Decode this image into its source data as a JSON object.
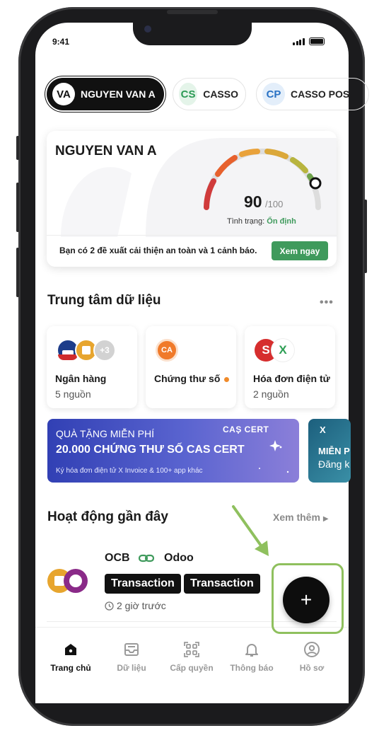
{
  "status_bar": {
    "time": "9:41"
  },
  "accounts": [
    {
      "initials": "VA",
      "name": "NGUYEN VAN A",
      "active": true
    },
    {
      "initials": "CS",
      "name": "CASSO",
      "active": false
    },
    {
      "initials": "CP",
      "name": "CASSO POS",
      "active": false
    }
  ],
  "score_card": {
    "name": "NGUYEN VAN A",
    "score": "90",
    "score_max": "/100",
    "status_label": "Tình trạng: ",
    "status_value": "Ổn định",
    "score_fraction": 0.9,
    "message": "Bạn có 2 đề xuất cải thiện an toàn và 1 cảnh báo.",
    "action_label": "Xem ngay",
    "accent_color": "#3f9a5c"
  },
  "data_center": {
    "title": "Trung tâm dữ liệu",
    "more_icon": "more-dots-icon",
    "cards": [
      {
        "title": "Ngân hàng",
        "subtitle": "5 nguồn",
        "badge": "+3"
      },
      {
        "title": "Chứng thư số",
        "subtitle": "",
        "icon_text": "CA"
      },
      {
        "title": "Hóa đơn điện tử",
        "subtitle": "2 nguồn",
        "icon_text_1": "S",
        "icon_text_2": "X"
      }
    ]
  },
  "banners": [
    {
      "line1": "QUÀ TẶNG MIỄN PHÍ",
      "line2": "20.000 CHỨNG THƯ SỐ CAS CERT",
      "line3": "Ký hóa đơn điện tử X Invoice & 100+ app khác",
      "logo": "CAS CERT"
    },
    {
      "line1": "MIỄN P",
      "line2": "Đăng k",
      "logo": "X"
    }
  ],
  "recent": {
    "title": "Hoạt động gần đây",
    "see_more": "Xem thêm",
    "item": {
      "from": "OCB",
      "to": "Odoo",
      "tags": [
        "Transaction",
        "Transaction"
      ],
      "time": "2 giờ trước"
    }
  },
  "fab": {
    "label": "+"
  },
  "tabs": [
    {
      "label": "Trang chủ",
      "icon": "home-icon",
      "active": true
    },
    {
      "label": "Dữ liệu",
      "icon": "inbox-icon",
      "active": false
    },
    {
      "label": "Cấp quyền",
      "icon": "grid-scan-icon",
      "active": false
    },
    {
      "label": "Thông báo",
      "icon": "bell-icon",
      "active": false
    },
    {
      "label": "Hồ sơ",
      "icon": "profile-icon",
      "active": false
    }
  ]
}
